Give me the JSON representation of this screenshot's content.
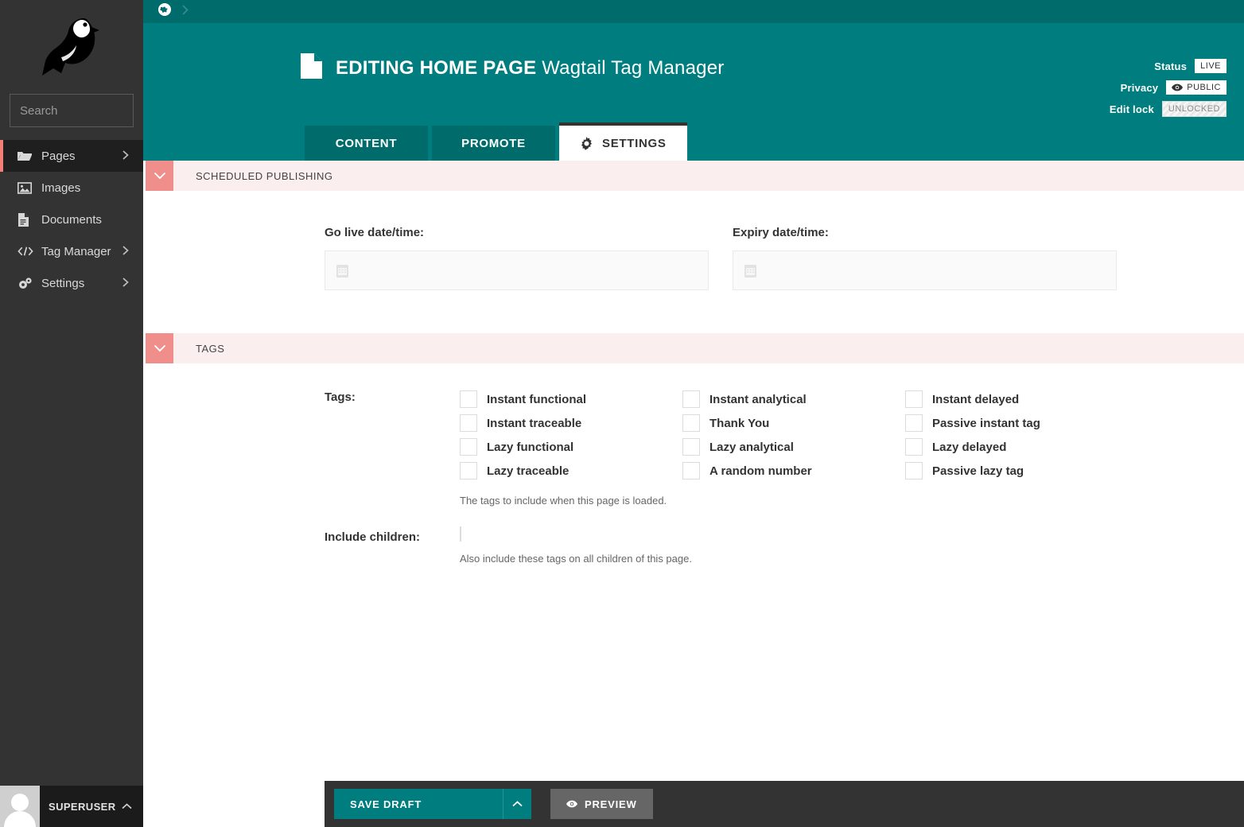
{
  "sidebar": {
    "logo_icon": "wagtail-bird-logo",
    "search": {
      "placeholder": "Search",
      "value": "",
      "icon": "search-icon"
    },
    "items": [
      {
        "label": "Pages",
        "icon": "folder-open-icon",
        "active": true,
        "has_chevron": true
      },
      {
        "label": "Images",
        "icon": "image-icon",
        "active": false,
        "has_chevron": false
      },
      {
        "label": "Documents",
        "icon": "document-icon",
        "active": false,
        "has_chevron": false
      },
      {
        "label": "Tag Manager",
        "icon": "code-icon",
        "active": true,
        "has_chevron": true
      },
      {
        "label": "Settings",
        "icon": "cogs-icon",
        "active": false,
        "has_chevron": true
      }
    ],
    "user": {
      "name": "SUPERUSER",
      "chevron": "chevron-up-icon",
      "avatar": "user-avatar"
    }
  },
  "breadcrumb": {
    "home_icon": "globe-icon",
    "separator": "chevron-right-icon"
  },
  "header": {
    "page_icon": "document-icon",
    "title_bold": "EDITING HOME PAGE",
    "title_rest": "Wagtail Tag Manager",
    "meta": [
      {
        "label": "Status",
        "badge": "LIVE",
        "icon": ""
      },
      {
        "label": "Privacy",
        "badge": "PUBLIC",
        "icon": "eye-icon"
      },
      {
        "label": "Edit lock",
        "badge": "UNLOCKED",
        "icon": ""
      }
    ]
  },
  "tabs": [
    {
      "label": "CONTENT",
      "icon": "",
      "active": false
    },
    {
      "label": "PROMOTE",
      "icon": "",
      "active": false
    },
    {
      "label": "SETTINGS",
      "icon": "gear-icon",
      "active": true
    }
  ],
  "sections": {
    "scheduled_publishing": {
      "title": "SCHEDULED PUBLISHING",
      "toggle_icon": "chevron-down-icon",
      "fields": [
        {
          "label": "Go live date/time:",
          "value": "",
          "icon": "calendar-icon"
        },
        {
          "label": "Expiry date/time:",
          "value": "",
          "icon": "calendar-icon"
        }
      ]
    },
    "tags": {
      "title": "TAGS",
      "toggle_icon": "chevron-down-icon",
      "tags_label": "Tags:",
      "columns": [
        [
          {
            "label": "Instant functional",
            "checked": false
          },
          {
            "label": "Instant traceable",
            "checked": false
          },
          {
            "label": "Lazy functional",
            "checked": false
          },
          {
            "label": "Lazy traceable",
            "checked": false
          }
        ],
        [
          {
            "label": "Instant analytical",
            "checked": false
          },
          {
            "label": "Thank You",
            "checked": false
          },
          {
            "label": "Lazy analytical",
            "checked": false
          },
          {
            "label": "A random number",
            "checked": false
          }
        ],
        [
          {
            "label": "Instant delayed",
            "checked": false
          },
          {
            "label": "Passive instant tag",
            "checked": false
          },
          {
            "label": "Lazy delayed",
            "checked": false
          },
          {
            "label": "Passive lazy tag",
            "checked": false
          }
        ]
      ],
      "tags_help": "The tags to include when this page is loaded.",
      "include_children_label": "Include children:",
      "include_children_checked": false,
      "include_children_help": "Also include these tags on all children of this page."
    }
  },
  "footer": {
    "save_label": "SAVE DRAFT",
    "save_caret_icon": "chevron-up-icon",
    "preview_label": "PREVIEW",
    "preview_icon": "eye-icon"
  },
  "colors": {
    "teal": "#007D7E",
    "teal_dark": "#006B6B",
    "salmon": "#ef8e8a",
    "pale_pink": "#fbeeee",
    "sidebar": "#333333",
    "sidebar_active": "#1f1f1f",
    "accent_red": "#f37e77"
  }
}
